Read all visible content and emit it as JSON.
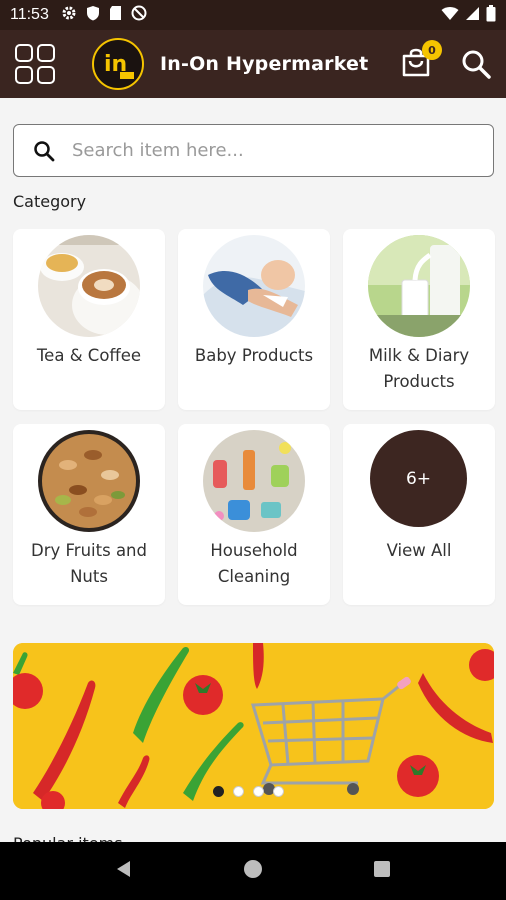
{
  "status_bar": {
    "time": "11:53"
  },
  "app_bar": {
    "title": "In-On Hypermarket",
    "cart_count": "0"
  },
  "search": {
    "placeholder": "Search item here..."
  },
  "categories_title": "Category",
  "categories": [
    {
      "label_line1": "Tea & Coffee",
      "label_line2": "",
      "image": "tea-coffee"
    },
    {
      "label_line1": "Baby Products",
      "label_line2": "",
      "image": "baby"
    },
    {
      "label_line1": "Milk & Diary",
      "label_line2": "Products",
      "image": "milk"
    },
    {
      "label_line1": "Dry Fruits and",
      "label_line2": "Nuts",
      "image": "nuts"
    },
    {
      "label_line1": "Household",
      "label_line2": "Cleaning",
      "image": "cleaning"
    },
    {
      "label_line1": "View All",
      "label_line2": "",
      "badge": "6+"
    }
  ],
  "banner": {
    "dots": 4,
    "active_dot": 0,
    "background": "#f7c31b"
  },
  "peek_text": "Popular items",
  "colors": {
    "appbar": "#3a2520",
    "status_bar": "#2d1c17",
    "accent": "#f5c400",
    "brown": "#3d2621"
  }
}
